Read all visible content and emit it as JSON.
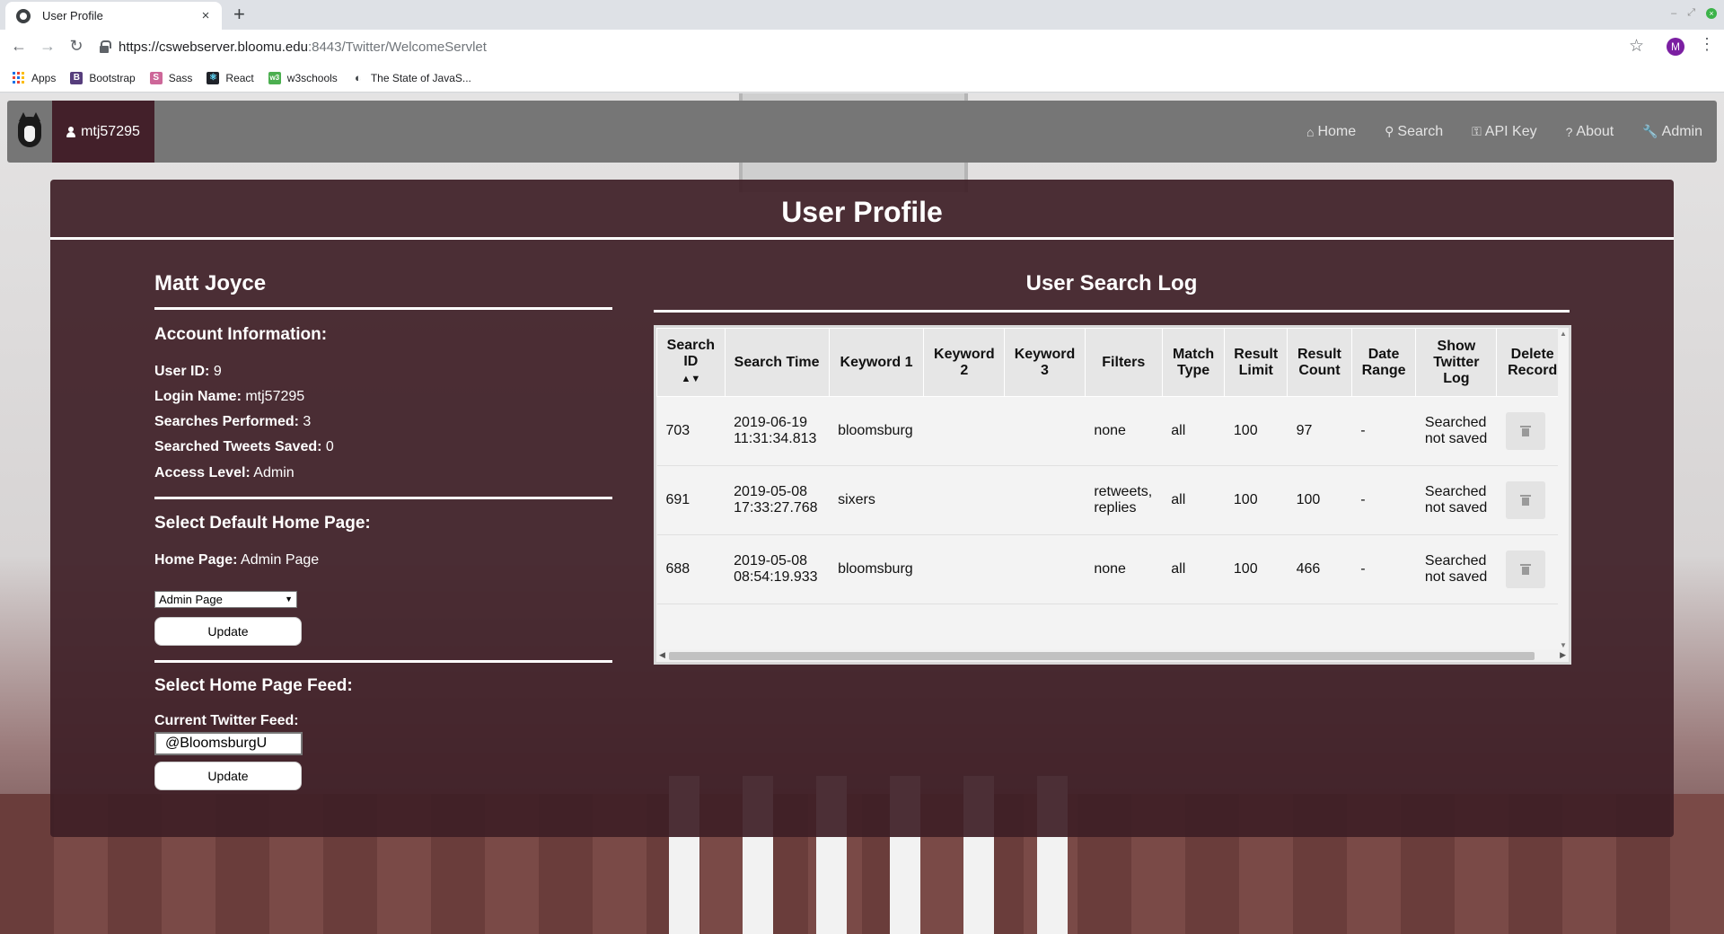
{
  "browser": {
    "tab_title": "User Profile",
    "tab_close": "×",
    "new_tab": "+",
    "url_host": "https://cswebserver.bloomu.edu",
    "url_path": ":8443/Twitter/WelcomeServlet",
    "profile_initial": "M",
    "bookmarks": [
      {
        "label": "Apps",
        "icon": "apps-grid-icon"
      },
      {
        "label": "Bootstrap",
        "icon": "bootstrap-icon",
        "color": "#563d7c",
        "glyph": "B"
      },
      {
        "label": "Sass",
        "icon": "sass-icon",
        "color": "#cd6799",
        "glyph": "S"
      },
      {
        "label": "React",
        "icon": "react-icon",
        "color": "#20232a",
        "glyph": "⚛"
      },
      {
        "label": "w3schools",
        "icon": "w3schools-icon",
        "color": "#4caf50",
        "glyph": "w3"
      },
      {
        "label": "The State of JavaS...",
        "icon": "globe-icon",
        "color": "#3c4043",
        "glyph": "◐"
      }
    ]
  },
  "navbar": {
    "username": "mtj57295",
    "links": [
      {
        "label": "Home",
        "icon": "home-icon",
        "glyph": "⌂"
      },
      {
        "label": "Search",
        "icon": "search-icon",
        "glyph": "⚲"
      },
      {
        "label": "API Key",
        "icon": "key-icon",
        "glyph": "⚿"
      },
      {
        "label": "About",
        "icon": "question-icon",
        "glyph": "?"
      },
      {
        "label": "Admin",
        "icon": "wrench-icon",
        "glyph": "🔧"
      }
    ]
  },
  "page": {
    "title": "User Profile"
  },
  "profile": {
    "name": "Matt Joyce",
    "account_heading": "Account Information:",
    "fields": [
      {
        "label": "User ID:",
        "value": "9"
      },
      {
        "label": "Login Name:",
        "value": "mtj57295"
      },
      {
        "label": "Searches Performed:",
        "value": "3"
      },
      {
        "label": "Searched Tweets Saved:",
        "value": "0"
      },
      {
        "label": "Access Level:",
        "value": "Admin"
      }
    ],
    "home_heading": "Select Default Home Page:",
    "home_label": "Home Page:",
    "home_value": "Admin Page",
    "home_select": "Admin Page",
    "update_label": "Update",
    "feed_heading": "Select Home Page Feed:",
    "feed_label": "Current Twitter Feed:",
    "feed_value": "@BloomsburgU",
    "feed_update_label": "Update"
  },
  "search_log": {
    "title": "User Search Log",
    "columns": [
      "Search ID",
      "Search Time",
      "Keyword 1",
      "Keyword 2",
      "Keyword 3",
      "Filters",
      "Match Type",
      "Result Limit",
      "Result Count",
      "Date Range",
      "Show Twitter Log",
      "Delete Record"
    ],
    "sort_indicator": "▲▼",
    "rows": [
      {
        "id": "703",
        "time": "2019-06-19 11:31:34.813",
        "k1": "bloomsburg",
        "k2": "",
        "k3": "",
        "filters": "none",
        "match": "all",
        "limit": "100",
        "count": "97",
        "range": "-",
        "log": "Searched not saved"
      },
      {
        "id": "691",
        "time": "2019-05-08 17:33:27.768",
        "k1": "sixers",
        "k2": "",
        "k3": "",
        "filters": "retweets, replies",
        "match": "all",
        "limit": "100",
        "count": "100",
        "range": "-",
        "log": "Searched not saved"
      },
      {
        "id": "688",
        "time": "2019-05-08 08:54:19.933",
        "k1": "bloomsburg",
        "k2": "",
        "k3": "",
        "filters": "none",
        "match": "all",
        "limit": "100",
        "count": "466",
        "range": "-",
        "log": "Searched not saved"
      }
    ]
  },
  "colors": {
    "panel": "#3e1e26",
    "user_chip": "#43202a",
    "navbar": "#767676"
  }
}
